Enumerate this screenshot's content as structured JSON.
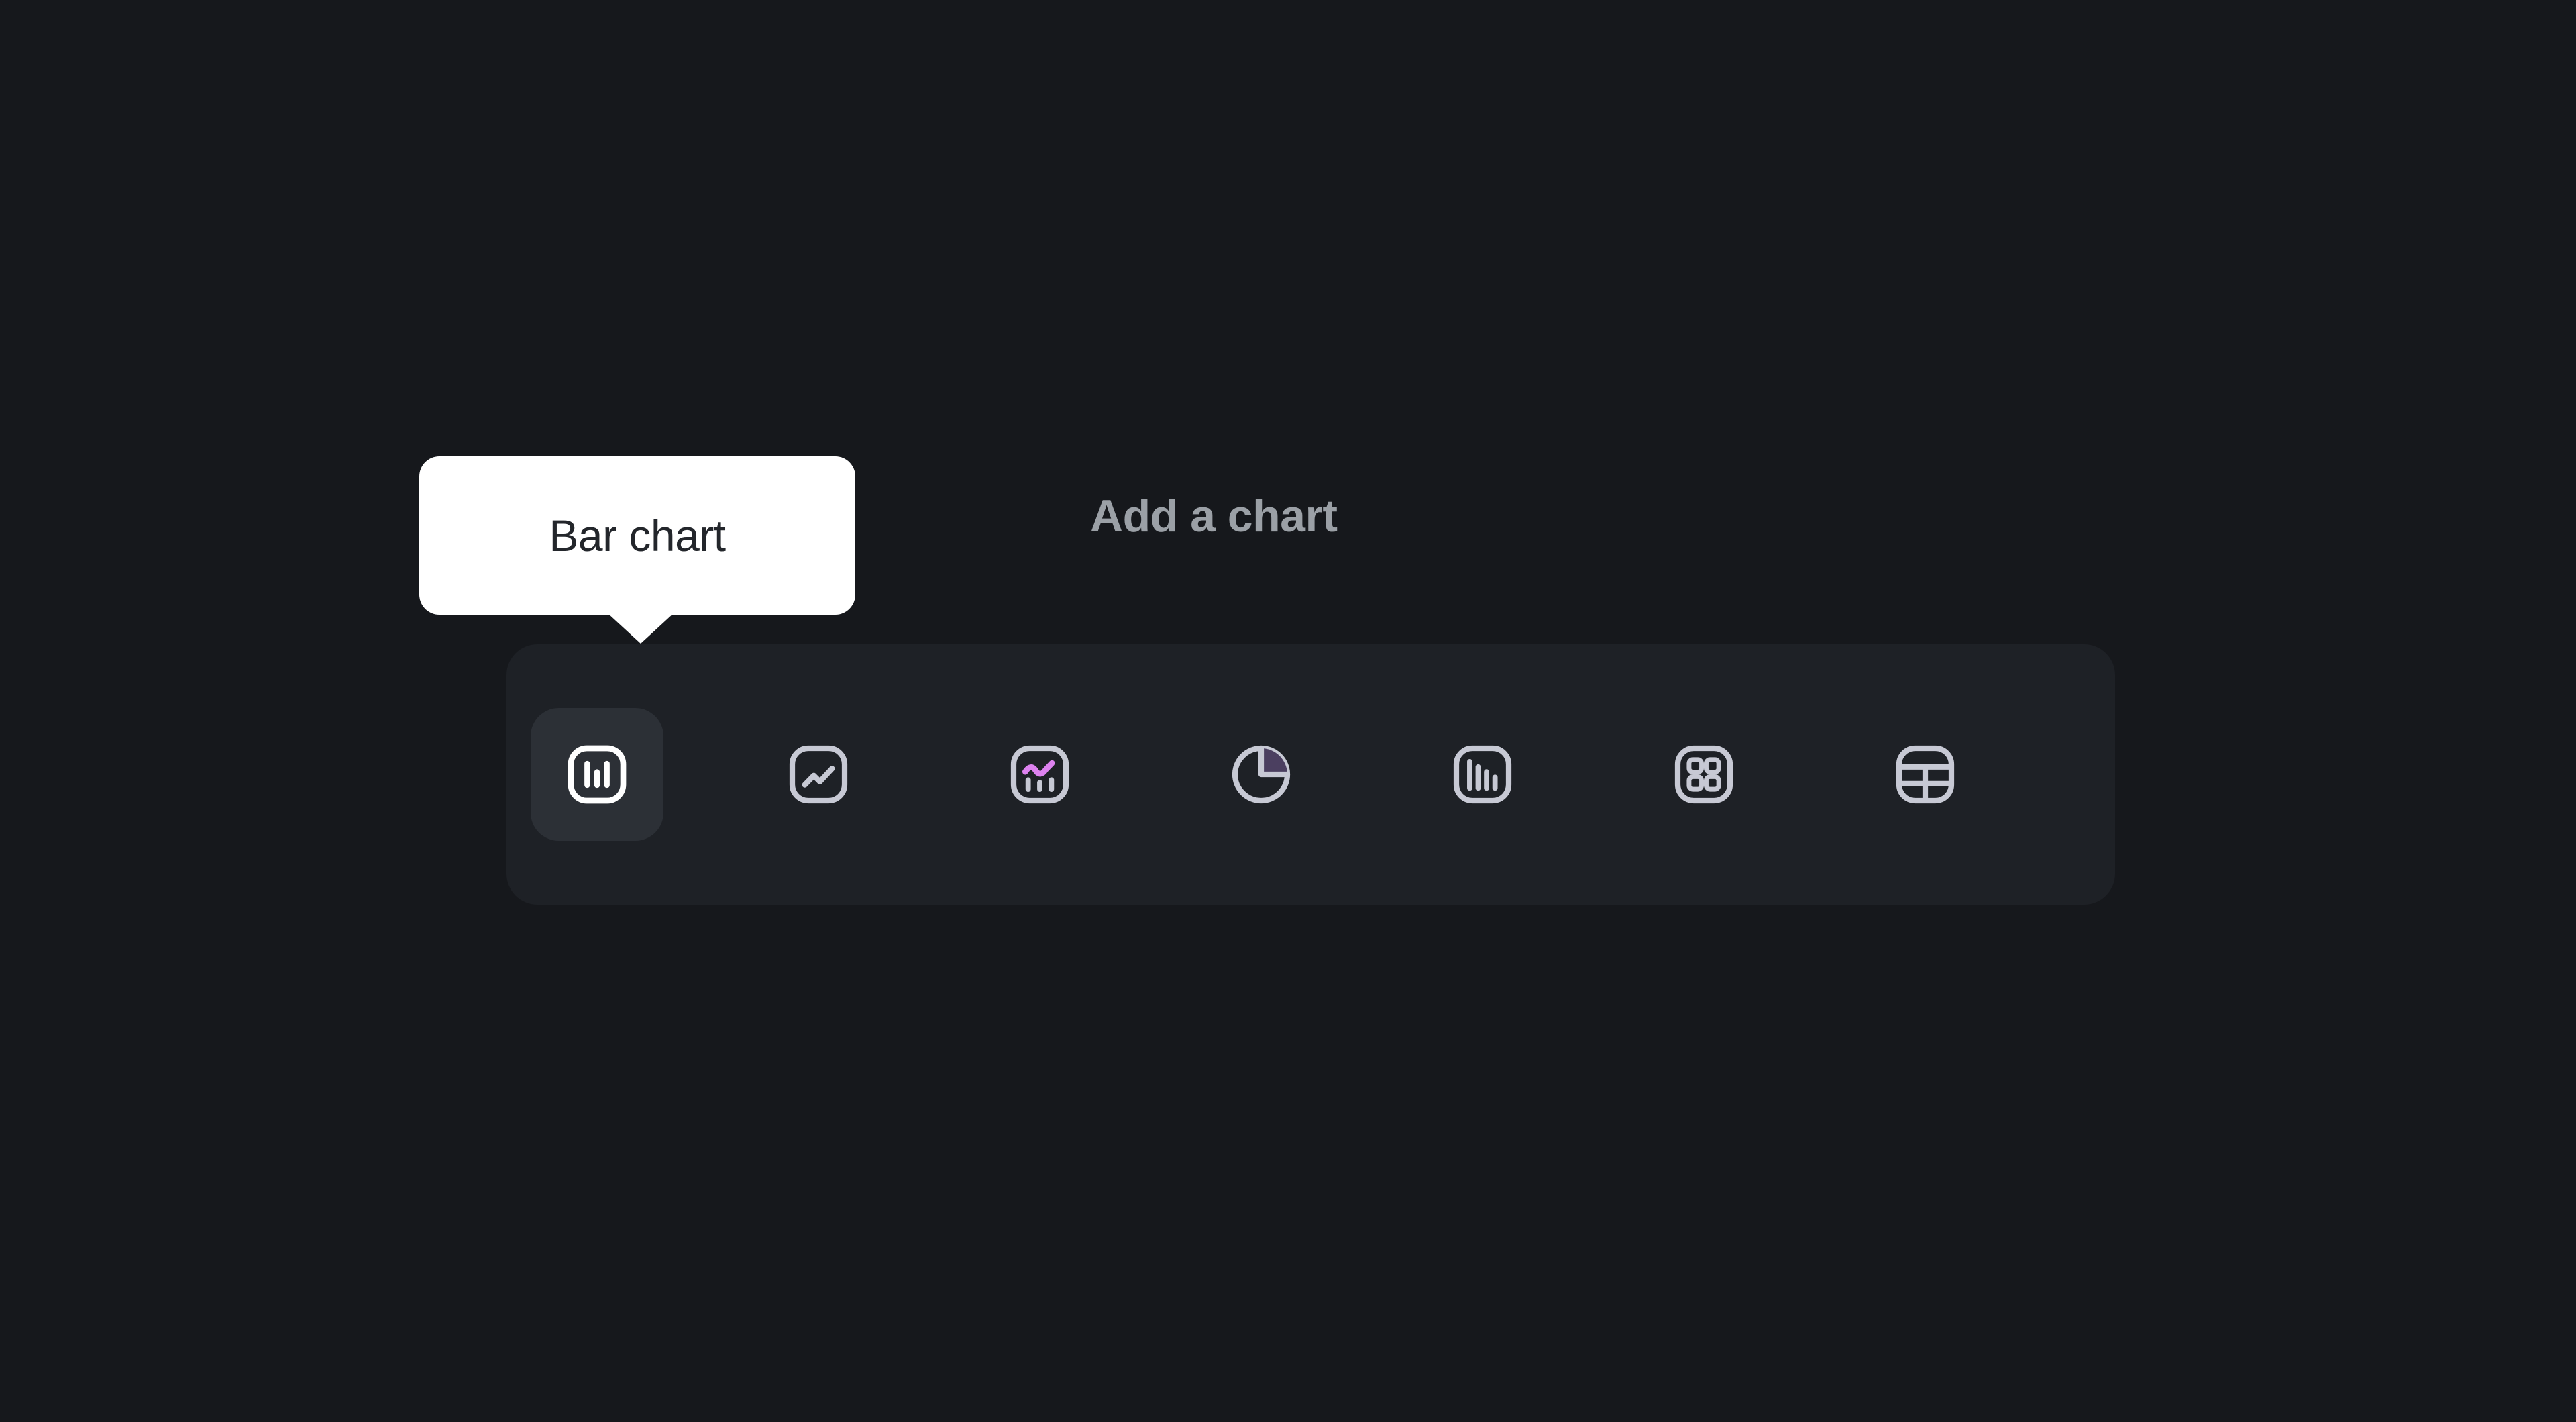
{
  "page": {
    "background_color": "#16181c"
  },
  "tooltip": {
    "label": "Bar chart",
    "background_color": "#ffffff",
    "text_color": "#23262b",
    "points_to": "chart-type-bar"
  },
  "header": {
    "title": "Add a chart",
    "text_color": "#9ba0a6"
  },
  "chart_picker": {
    "background_color": "#1e2126",
    "selected_item_background": "#2c3036",
    "accent_color": "#dd82ef",
    "selected_index": 0,
    "items": [
      {
        "id": "bar",
        "label": "Bar chart",
        "icon": "bar-chart-icon",
        "selected": true
      },
      {
        "id": "line",
        "label": "Line chart",
        "icon": "line-chart-icon",
        "selected": false
      },
      {
        "id": "combo",
        "label": "Combo chart",
        "icon": "combo-chart-icon",
        "selected": false
      },
      {
        "id": "pie",
        "label": "Pie chart",
        "icon": "pie-chart-icon",
        "selected": false
      },
      {
        "id": "column",
        "label": "Column chart",
        "icon": "column-chart-icon",
        "selected": false
      },
      {
        "id": "grid",
        "label": "Grid",
        "icon": "grid-icon",
        "selected": false
      },
      {
        "id": "table",
        "label": "Table",
        "icon": "table-icon",
        "selected": false
      }
    ]
  }
}
